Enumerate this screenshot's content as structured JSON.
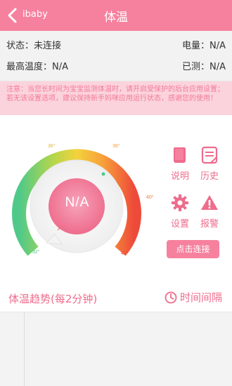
{
  "header": {
    "back_label": "ibaby",
    "title": "体温",
    "background": "#f6819e"
  },
  "status": {
    "state_label": "状态：未连接",
    "battery_label": "电量：N/A",
    "max_temp_label": "最高温度：N/A",
    "elapsed_label": "已测：N/A"
  },
  "notice": {
    "text": "注意：当您长时间为宝宝监测体温时，请开启受保护的后台应用设置；若无该设置选项，建议保持新手妈咪应用运行状态，感谢您的使用！"
  },
  "gauge": {
    "value": "N/A",
    "ticks": [
      "34°",
      "36°",
      "38°",
      "40°",
      "42°",
      "32°"
    ]
  },
  "actions": {
    "instructions": "说明",
    "history": "历史",
    "settings": "设置",
    "alarm": "报警",
    "connect": "点击连接"
  },
  "trend": {
    "label": "体温趋势(每2分钟)",
    "interval": "时间间隔"
  },
  "colors": {
    "accent": "#f6819e",
    "accent_text": "#ee6c8c",
    "notice_bg": "#fbd3dc"
  },
  "icons": {
    "back": "chevron-left-icon",
    "instructions": "book-icon",
    "history": "document-icon",
    "settings": "gear-icon",
    "alarm": "warning-icon",
    "interval": "clock-icon"
  }
}
